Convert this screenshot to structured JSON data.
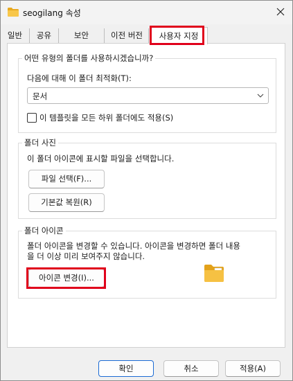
{
  "window": {
    "title": "seogilang 속성",
    "icon": "folder-icon",
    "close_icon": "close-icon"
  },
  "tabs": [
    {
      "label": "일반",
      "active": false
    },
    {
      "label": "공유",
      "active": false
    },
    {
      "label": "보안",
      "active": false
    },
    {
      "label": "이전 버전",
      "active": false
    },
    {
      "label": "사용자 지정",
      "active": true
    }
  ],
  "folder_type": {
    "legend": "어떤 유형의 폴더를 사용하시겠습니까?",
    "optimize_label": "다음에 대해 이 폴더 최적화(T):",
    "optimize_value": "문서",
    "apply_template_label": "이 템플릿을 모든 하위 폴더에도 적용(S)",
    "apply_template_checked": false
  },
  "folder_picture": {
    "legend": "폴더 사진",
    "description": "이 폴더 아이콘에 표시할 파일을 선택합니다.",
    "choose_file_label": "파일 선택(F)...",
    "restore_default_label": "기본값 복원(R)"
  },
  "folder_icon": {
    "legend": "폴더 아이콘",
    "description_line1": "폴더 아이콘을 변경할 수 있습니다. 아이콘을 변경하면 폴더 내용",
    "description_line2": "을 더 이상  미리 보여주지 않습니다.",
    "change_icon_label": "아이콘 변경(I)...",
    "preview_icon": "folder-icon"
  },
  "footer": {
    "ok_label": "확인",
    "cancel_label": "취소",
    "apply_label": "적용(A)"
  },
  "colors": {
    "highlight": "#e0001b",
    "folder_yellow": "#f6c143",
    "accent": "#1a6ad4"
  }
}
